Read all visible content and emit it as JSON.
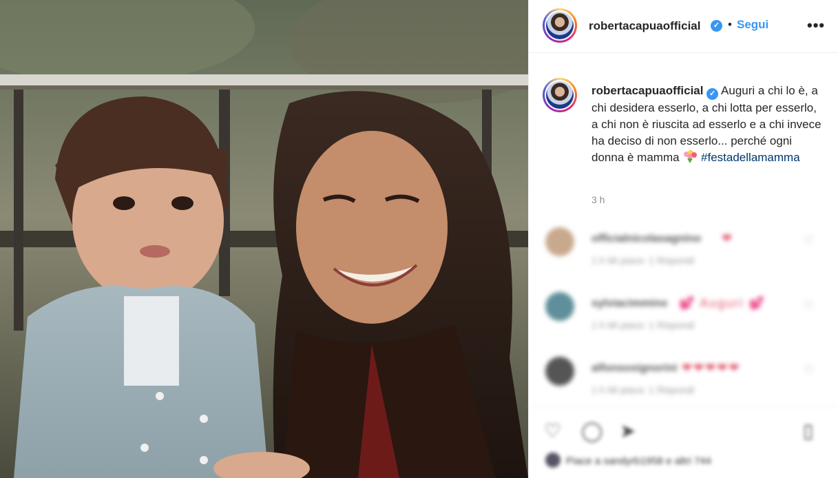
{
  "post": {
    "username": "robertacapuaofficial",
    "verified": true,
    "follow_separator": "•",
    "follow_label": "Segui",
    "more_label": "•••"
  },
  "caption": {
    "username": "robertacapuaofficial",
    "text": "Auguri a chi lo è, a chi desidera esserlo, a chi lotta per esserlo, a chi non è riuscita ad esserlo e a chi invece ha deciso di non esserlo... perché ogni donna è mamma",
    "emoji_icon": "flower-bouquet-icon",
    "hashtag": "#festadellamamma",
    "time": "3 h"
  },
  "comments": [
    {
      "user": "officialnicolasagnino",
      "hearts": "❤",
      "meta": "1 h   Mi piace: 1   Rispondi",
      "avatar_color": "#c9a98e"
    },
    {
      "user": "sylviacimmino",
      "hearts": "💕 Auguri 💕",
      "meta": "1 h   Mi piace: 1   Rispondi",
      "avatar_color": "#5f8f9a"
    },
    {
      "user": "alfonsosignorini",
      "hearts": "❤❤❤❤❤",
      "meta": "1 h   Mi piace: 1   Rispondi",
      "avatar_color": "#555555"
    }
  ],
  "actions": {
    "like_icon": "heart-icon",
    "comment_icon": "comment-icon",
    "share_icon": "share-icon",
    "save_icon": "bookmark-icon",
    "likes_text": "Piace a sandyrb1958 e altri 744"
  },
  "colors": {
    "accent": "#3897f0",
    "hashtag": "#00376b",
    "muted": "#8e8e8e"
  }
}
